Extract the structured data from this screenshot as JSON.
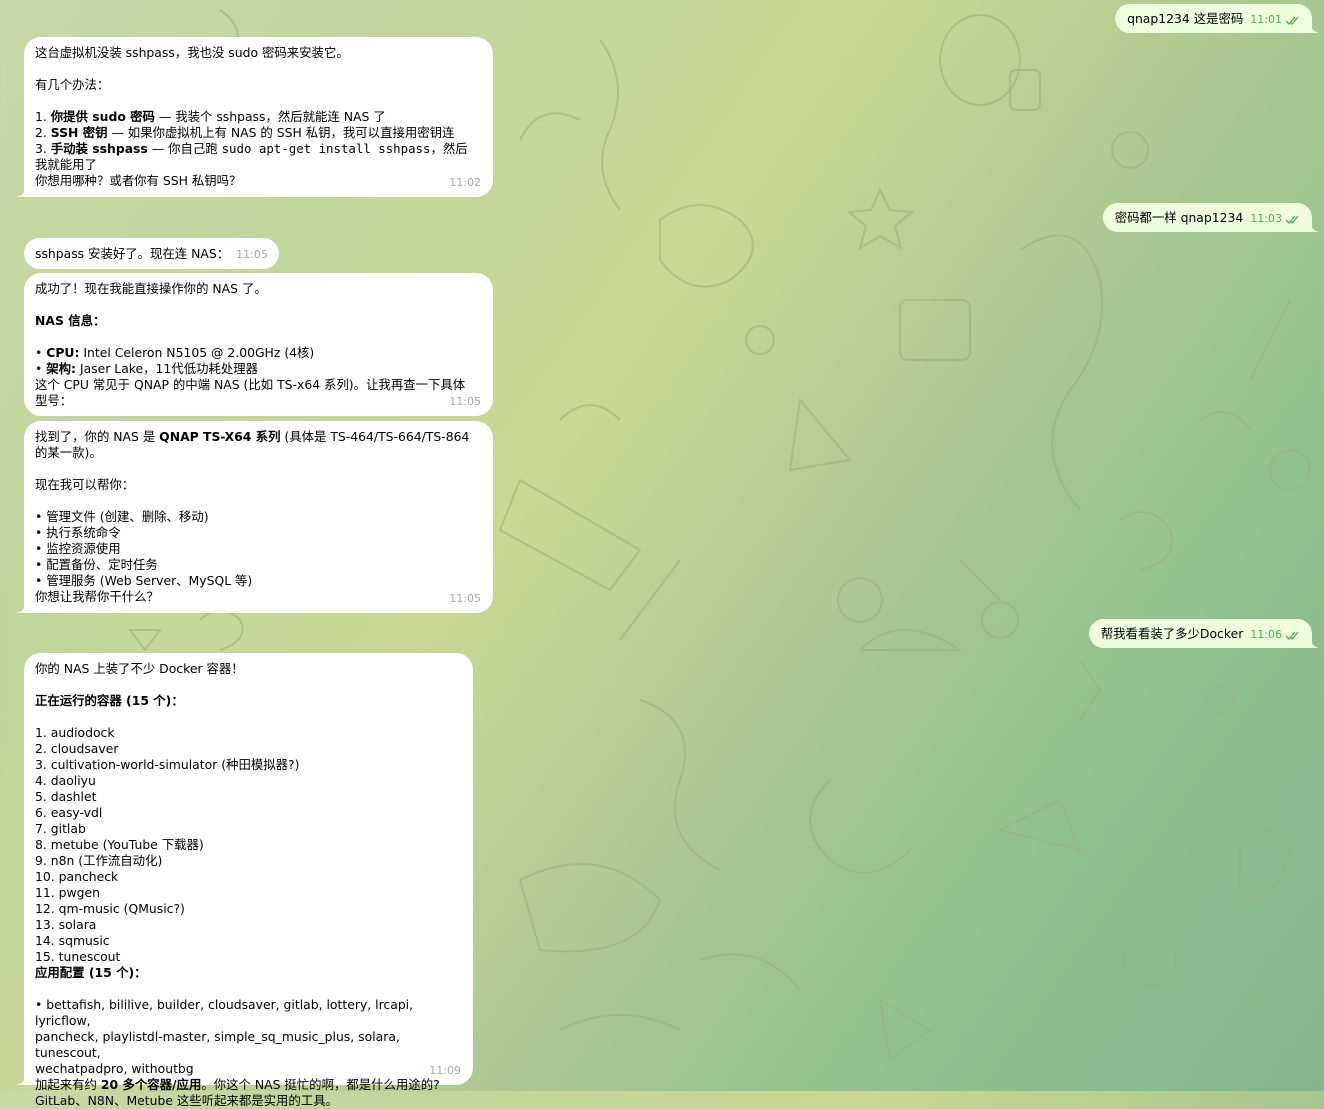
{
  "colors": {
    "incoming_bubble": "#ffffff",
    "outgoing_bubble": "#eeffde",
    "outgoing_time": "#4fae4e",
    "incoming_time": "#a3a8ad"
  },
  "messages": {
    "m1": {
      "text": "qnap1234 这是密码",
      "time": "11:01"
    },
    "m2": {
      "l1": "这台虚拟机没装 sshpass，我也没 sudo 密码来安装它。",
      "l2": "有几个办法：",
      "l3_b": "你提供 sudo 密码",
      "l3_n": "1. ",
      "l3_r": " — 我装个 sshpass，然后就能连 NAS 了",
      "l4_n": "2. ",
      "l4_b": "SSH 密钥",
      "l4_r": " — 如果你虚拟机上有 NAS 的 SSH 私钥，我可以直接用密钥连",
      "l5_n": "3. ",
      "l5_b": "手动装 sshpass",
      "l5_m": " — 你自己跑 ",
      "l5_c": "sudo apt-get install sshpass",
      "l5_r": "，然后",
      "l6": "我就能用了",
      "l7": "你想用哪种？或者你有 SSH 私钥吗？",
      "time": "11:02"
    },
    "m3": {
      "text": "密码都一样 qnap1234",
      "time": "11:03"
    },
    "m4": {
      "text": "sshpass 安装好了。现在连 NAS：",
      "time": "11:05"
    },
    "m5": {
      "l1": "成功了！现在我能直接操作你的 NAS 了。",
      "l2_b": "NAS 信息：",
      "l3_p": "• ",
      "l3_b": "CPU:",
      "l3_r": " Intel Celeron N5105 @ 2.00GHz (4核)",
      "l4_p": "• ",
      "l4_b": "架构:",
      "l4_r": " Jaser Lake，11代低功耗处理器",
      "l5": "这个 CPU 常见于 QNAP 的中端 NAS (比如 TS-x64 系列)。让我再查一下具体",
      "l6": "型号：",
      "time": "11:05"
    },
    "m6": {
      "l1_a": "找到了，你的 NAS 是 ",
      "l1_b": "QNAP TS-X64 系列",
      "l1_c": " (具体是 TS-464/TS-664/TS-864",
      "l2": "的某一款)。",
      "l3": "现在我可以帮你：",
      "items": [
        "• 管理文件 (创建、删除、移动)",
        "• 执行系统命令",
        "• 监控资源使用",
        "• 配置备份、定时任务",
        "• 管理服务 (Web Server、MySQL 等)"
      ],
      "l9": "你想让我帮你干什么？",
      "time": "11:05"
    },
    "m7": {
      "text": "帮我看看装了多少Docker",
      "time": "11:06"
    },
    "m8": {
      "l1": "你的 NAS 上装了不少 Docker 容器！",
      "h1": "正在运行的容器 (15 个)：",
      "containers": [
        "1. audiodock",
        "2. cloudsaver",
        "3. cultivation-world-simulator (种田模拟器?)",
        "4. daoliyu",
        "5. dashlet",
        "6. easy-vdl",
        "7. gitlab",
        "8. metube (YouTube 下载器)",
        "9. n8n (工作流自动化)",
        "10. pancheck",
        "11. pwgen",
        "12. qm-music (QMusic?)",
        "13. solara",
        "14. sqmusic",
        "15. tunescout"
      ],
      "h2": "应用配置 (15 个)：",
      "apps1": "• bettafish, bililive, builder, cloudsaver, gitlab, lottery, lrcapi, lyricflow,",
      "apps2": "pancheck, playlistdl-master, simple_sq_music_plus, solara, tunescout,",
      "apps3": "wechatpadpro, withoutbg",
      "s1_a": "加起来有约 ",
      "s1_b": "20 多个容器/应用",
      "s1_c": "。你这个 NAS 挺忙的啊，都是什么用途的?",
      "s2": "GitLab、N8N、Metube 这些听起来都是实用的工具。",
      "time": "11:09"
    }
  }
}
